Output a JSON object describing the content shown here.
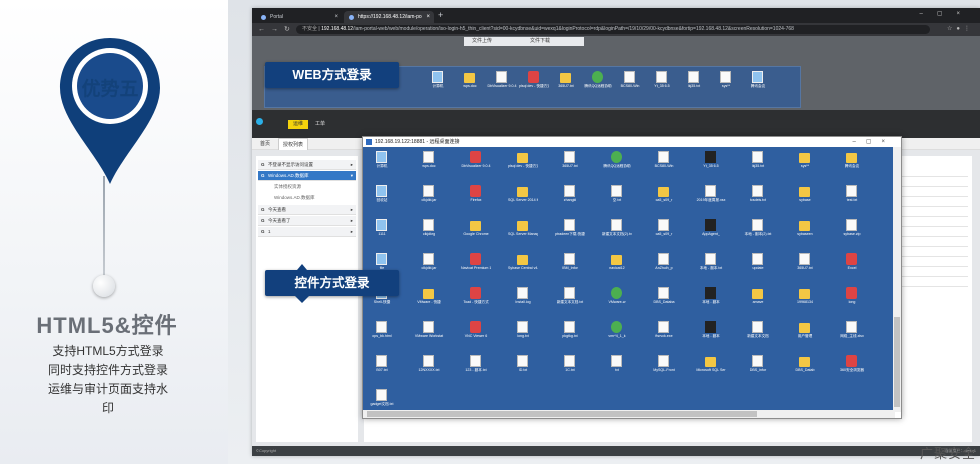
{
  "left": {
    "badge": "优势五",
    "headline": "HTML5&控件",
    "lines": [
      "支持HTML5方式登录",
      "同时支持控件方式登录",
      "运维与审计页面支持水",
      "印"
    ]
  },
  "callouts": {
    "web": "WEB方式登录",
    "control": "控件方式登录"
  },
  "browser": {
    "tabs": [
      "Portal",
      "https://192.168.48.12/iam-po"
    ],
    "address_warning": "不安全",
    "address_host": "192.168.48.12",
    "address_path": "/iam-portal-web/web/module/operation/iso-login-h5_thin_client?sid=00-kcydbnse&uid=wexq1&loginProtocol=rdp&loginPath=/19/10/29/00-kcydbnse&fortip=192.168.48.12&screenResolution=1024-768",
    "toolbar": [
      "文件上传",
      "文件下载"
    ]
  },
  "portal": {
    "tabs": [
      "运维",
      "工单"
    ],
    "subtabs": [
      "首页",
      "授权列表"
    ],
    "sidebar": [
      {
        "label": "不登录不显示访问设置",
        "highlight": false
      },
      {
        "label": "Windows.AD.数据库",
        "highlight": true
      },
      {
        "label": "今天查看",
        "highlight": false
      },
      {
        "label": "今天查看了",
        "highlight": false
      },
      {
        "label": "1",
        "highlight": false
      }
    ],
    "sidebar_sub": [
      "实体授权资源",
      "Windows.AD.数据库"
    ],
    "copyright": "©Copyright",
    "status_right": "当前用户：wexq1"
  },
  "rdp": {
    "title": "192.168.19.122:18881 - 远程桌面连接",
    "icons": [
      "计算机",
      "wps.doc",
      "DbVisualizer 9.0.4",
      "plsql dev - 快捷方式",
      "365U7.txt",
      "腾讯QQ远程协助",
      "BCS80-Win",
      "Yt_35 6.5",
      "lkj35.txt",
      "sys**",
      "腾讯会议",
      "回收站",
      "clkjdkt.jar",
      "Firefox",
      "SQL Server 2014 Ma",
      "zhangkl",
      "空.txt",
      "ca5_s09_r",
      "2019年度周报.xsx",
      "tcsdeis.txt",
      "sybase",
      "test.txt",
      "1111",
      "clkjdkrg",
      "Google Chrome",
      "SQL Server Manageme",
      "ptradeen下载-快捷",
      "新建文本文档(2).txt",
      "ca5_s09_r",
      "AppAgent_",
      "本地 - 副本(2).txt",
      "sybaseen",
      "sybase.zip",
      "file",
      "clkjdkt.jar",
      "Navicat Premium 12",
      "Sybase Central v4.3",
      "IBM_Infor",
      "navicat12",
      "AnZhuih_p",
      "本地 - 副本.txt",
      "update",
      "365U7.txt",
      "Excel",
      "Shell-快捷",
      "VMware - 快捷",
      "Toad - 快捷方式",
      "Install.log",
      "新建文本文档.txt",
      "VMware-w",
      "DBS_Databa",
      "本地 - 副本",
      "amave",
      "19968134",
      "long",
      "ops_bk.html",
      "VMware Workstat",
      "VNC Viewer 6",
      "long.txt",
      "pkgtkg.txt",
      "vmr*4_1_k",
      "ftsrvck.exe",
      "本地 - 副本",
      "新建文本文档",
      "用户管理",
      "网络_主线.xlsx",
      "B07.txt",
      "12NXXXX.txt",
      "123 - 副本.txt",
      "ID.txt",
      "1C.txt",
      "txt",
      "MySQL-Front",
      "Microsoft SQL Ser",
      "DBS_infor",
      "DBS_Datab",
      "360安全浏览器",
      "gadget文档.txt"
    ]
  },
  "brand": "广聚安全"
}
